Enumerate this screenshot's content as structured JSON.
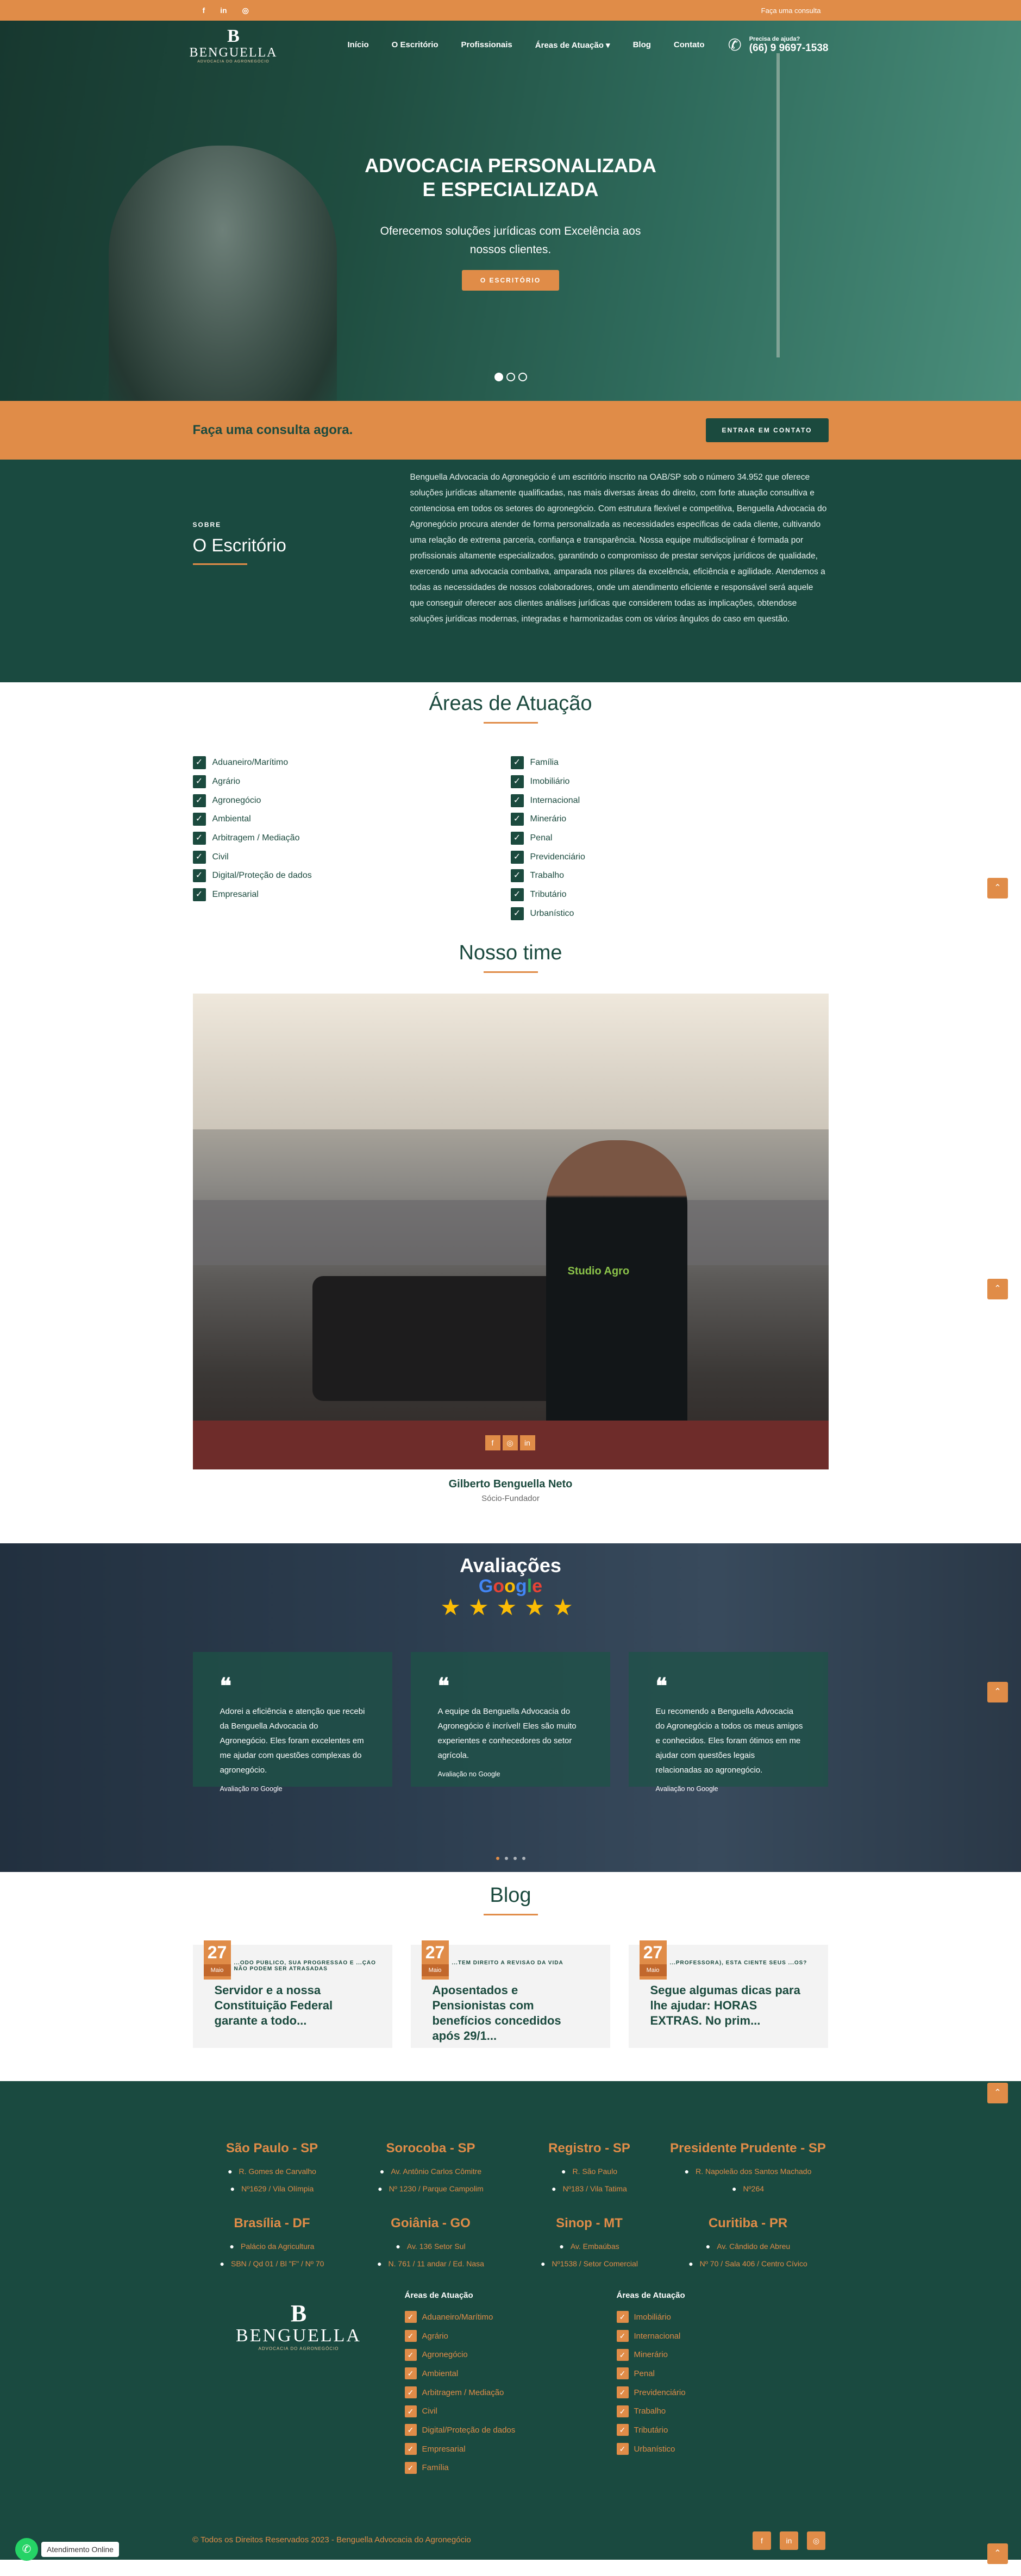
{
  "topbar": {
    "social": [
      "f",
      "in",
      "◎"
    ],
    "link": "Faça uma consulta"
  },
  "nav": {
    "logo": {
      "mark": "B",
      "name": "BENGUELLA",
      "sub": "ADVOCACIA DO AGRONEGÓCIO"
    },
    "items": [
      "Início",
      "O Escritório",
      "Profissionais",
      "Áreas de Atuação ▾",
      "Blog",
      "Contato"
    ],
    "help_label": "Precisa de ajuda?",
    "phone": "(66) 9 9697-1538"
  },
  "hero": {
    "title": "ADVOCACIA PERSONALIZADA E ESPECIALIZADA",
    "subtitle": "Oferecemos soluções jurídicas com Excelência aos nossos clientes.",
    "button": "O ESCRITÓRIO",
    "slides": 3,
    "active_slide": 1
  },
  "consult": {
    "text": "Faça uma consulta agora.",
    "button": "ENTRAR EM CONTATO"
  },
  "about": {
    "kicker": "SOBRE",
    "title": "O Escritório",
    "text": "Benguella Advocacia do Agronegócio é um escritório inscrito na OAB/SP sob o número 34.952 que oferece soluções jurídicas altamente qualificadas, nas mais diversas áreas do direito, com forte atuação consultiva e contenciosa em todos os setores do agronegócio. Com estrutura flexível e competitiva, Benguella Advocacia do Agronegócio procura atender de forma personalizada as necessidades específicas de cada cliente, cultivando uma relação de extrema parceria, confiança e transparência. Nossa equipe multidisciplinar é formada por profissionais altamente especializados, garantindo o compromisso de prestar serviços jurídicos de qualidade, exercendo uma advocacia combativa, amparada nos pilares da excelência, eficiência e agilidade. Atendemos a todas as necessidades de nossos colaboradores, onde um atendimento eficiente e responsável será aquele que conseguir oferecer aos clientes análises jurídicas que considerem todas as implicações, obtendose soluções jurídicas modernas, integradas e harmonizadas com os vários ângulos do caso em questão."
  },
  "areas": {
    "title": "Áreas de Atuação",
    "left": [
      "Aduaneiro/Marítimo",
      "Agrário",
      "Agronegócio",
      "Ambiental",
      "Arbitragem / Mediação",
      "Civil",
      "Digital/Proteção de dados",
      "Empresarial"
    ],
    "right": [
      "Família",
      "Imobiliário",
      "Internacional",
      "Minerário",
      "Penal",
      "Previdenciário",
      "Trabalho",
      "Tributário",
      "Urbanístico"
    ]
  },
  "team": {
    "title": "Nosso time",
    "shirt": "Studio Agro",
    "name": "Gilberto Benguella Neto",
    "role": "Sócio-Fundador",
    "social": [
      "f",
      "◎",
      "in"
    ]
  },
  "reviews": {
    "title": "Avaliações",
    "google": [
      "G",
      "o",
      "o",
      "g",
      "l",
      "e"
    ],
    "stars": "★★★★★",
    "quote": "❝",
    "items": [
      {
        "text": "Adorei a eficiência e atenção que recebi da Benguella Advocacia do Agronegócio. Eles foram excelentes em me ajudar com questões complexas do agronegócio.",
        "source": "Avaliação no Google"
      },
      {
        "text": "A equipe da Benguella Advocacia do Agronegócio é incrível! Eles são muito experientes e conhecedores do setor agrícola.",
        "source": "Avaliação no Google"
      },
      {
        "text": "Eu recomendo a Benguella Advocacia do Agronegócio a todos os meus amigos e conhecidos. Eles foram ótimos em me ajudar com questões legais relacionadas ao agronegócio.",
        "source": "Avaliação no Google"
      }
    ]
  },
  "blog": {
    "title": "Blog",
    "posts": [
      {
        "day": "27",
        "month": "Maio",
        "tag": "...ODO PÚBLICO, SUA PROGRESSÃO E ...ÇÃO NÃO PODEM SER ATRASADAS",
        "title": "Servidor e a nossa Constituição Federal garante a todo..."
      },
      {
        "day": "27",
        "month": "Maio",
        "tag": "...TEM DIREITO A REVISÃO DA VIDA",
        "title": "Aposentados e Pensionistas com benefícios concedidos após 29/1..."
      },
      {
        "day": "27",
        "month": "Maio",
        "tag": "...PROFESSORA), ESTA CIENTE SEUS ...OS?",
        "title": "Segue algumas dicas para lhe ajudar:   HORAS EXTRAS.   No prim..."
      }
    ]
  },
  "offices": [
    {
      "city": "São Paulo - SP",
      "l1": "R. Gomes de Carvalho",
      "l2": "Nº1629 / Vila Olímpia"
    },
    {
      "city": "Sorocoba - SP",
      "l1": "Av. Antônio Carlos Cômitre",
      "l2": "Nº 1230 / Parque Campolim"
    },
    {
      "city": "Registro - SP",
      "l1": "R. São Paulo",
      "l2": "Nº183 / Vila Tatima"
    },
    {
      "city": "Presidente Prudente - SP",
      "l1": "R. Napoleão dos Santos Machado",
      "l2": "Nº264"
    },
    {
      "city": "Brasília - DF",
      "l1": "Palácio da Agricultura",
      "l2": "SBN / Qd 01 / Bl \"F\" / Nº 70"
    },
    {
      "city": "Goiânia - GO",
      "l1": "Av. 136 Setor Sul",
      "l2": "N. 761 / 11 andar / Ed. Nasa"
    },
    {
      "city": "Sinop - MT",
      "l1": "Av. Embaúbas",
      "l2": "Nº1538 / Setor Comercial"
    },
    {
      "city": "Curitiba - PR",
      "l1": "Av. Cândido de Abreu",
      "l2": "Nº 70 / Sala 406 / Centro Cívico"
    }
  ],
  "footer": {
    "logo": {
      "mark": "B",
      "name": "BENGUELLA",
      "sub": "ADVOCACIA DO AGRONEGÓCIO"
    },
    "col1_title": "Áreas de Atuação",
    "col1": [
      "Aduaneiro/Marítimo",
      "Agrário",
      "Agronegócio",
      "Ambiental",
      "Arbitragem / Mediação",
      "Civil",
      "Digital/Proteção de dados",
      "Empresarial",
      "Família"
    ],
    "col2_title": "Áreas de Atuação",
    "col2": [
      "Imobiliário",
      "Internacional",
      "Minerário",
      "Penal",
      "Previdenciário",
      "Trabalho",
      "Tributário",
      "Urbanístico"
    ],
    "copyright": "© Todos os Direitos Reservados 2023 - Benguella Advocacia do Agronegócio",
    "social": [
      "f",
      "in",
      "◎"
    ]
  },
  "floating": {
    "whatsapp_label": "Atendimento Online",
    "top": "⌃"
  },
  "colors": {
    "accent": "#e08c48",
    "brand": "#1b4a3e"
  }
}
